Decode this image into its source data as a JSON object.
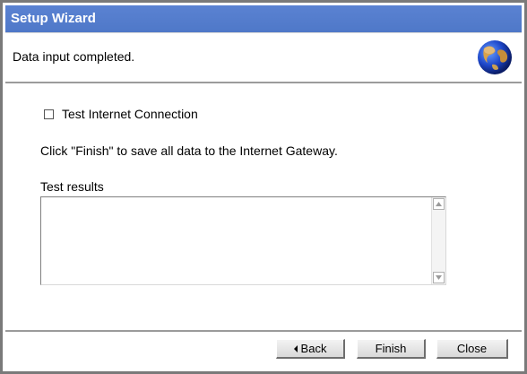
{
  "window": {
    "title": "Setup Wizard"
  },
  "header": {
    "message": "Data input completed.",
    "icon": "globe-icon"
  },
  "content": {
    "test_checkbox": {
      "label": "Test Internet Connection",
      "checked": false
    },
    "info": "Click \"Finish\" to save all data to the Internet Gateway.",
    "results_label": "Test results",
    "results_value": ""
  },
  "footer": {
    "back_label": "Back",
    "finish_label": "Finish",
    "close_label": "Close"
  },
  "colors": {
    "titlebar": "#5a82d2",
    "frame": "#7a7a7a"
  }
}
